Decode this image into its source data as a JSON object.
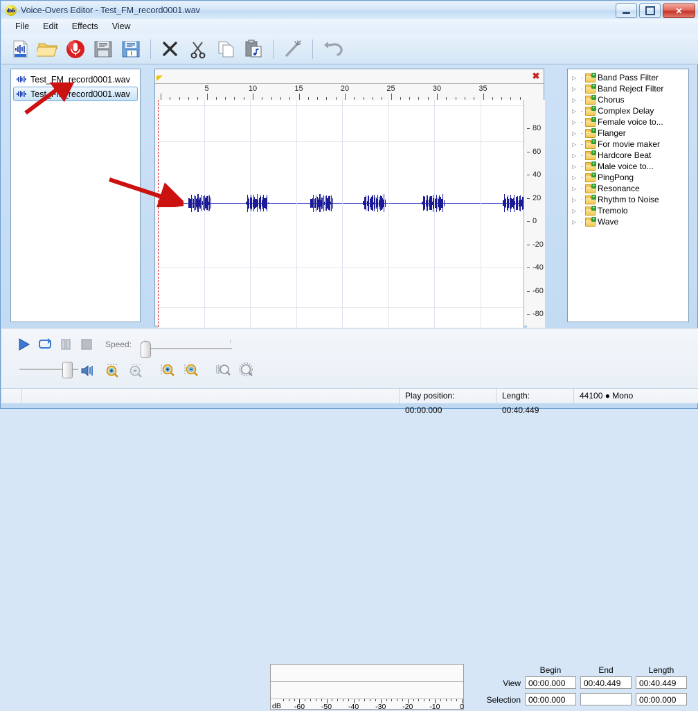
{
  "window": {
    "title": "Voice-Overs Editor - Test_FM_record0001.wav",
    "app_icon": "waveform-icon",
    "minimize": "–",
    "maximize": "▫",
    "close": "✕"
  },
  "menu": {
    "items": [
      "File",
      "Edit",
      "Effects",
      "View"
    ]
  },
  "toolbar": {
    "buttons": [
      {
        "name": "new-file-icon",
        "label": "New"
      },
      {
        "name": "open-folder-icon",
        "label": "Open"
      },
      {
        "name": "record-icon",
        "label": "Record"
      },
      {
        "name": "save-icon",
        "label": "Save"
      },
      {
        "name": "save-as-icon",
        "label": "Save As"
      },
      {
        "name": "delete-icon",
        "label": "Delete"
      },
      {
        "name": "cut-icon",
        "label": "Cut"
      },
      {
        "name": "copy-icon",
        "label": "Copy"
      },
      {
        "name": "paste-icon",
        "label": "Paste"
      },
      {
        "name": "magic-wand-icon",
        "label": "Effects"
      },
      {
        "name": "undo-icon",
        "label": "Undo"
      }
    ]
  },
  "file_list": {
    "items": [
      {
        "label": "Test_FM_record0001.wav",
        "selected": false
      },
      {
        "label": "Test_FM_record0001.wav",
        "selected": true
      }
    ]
  },
  "editor": {
    "close_label": "✖",
    "ruler_ticks": [
      "5",
      "10",
      "15",
      "20",
      "25",
      "30",
      "35"
    ],
    "amplitude_ticks": [
      "80",
      "60",
      "40",
      "20",
      "0",
      "-20",
      "-40",
      "-60",
      "-80"
    ],
    "waveform_color": "#1b1b96",
    "centerline_color": "#4b4bd6",
    "playhead_color": "#e02020"
  },
  "effects": {
    "items": [
      "Band Pass Filter",
      "Band Reject Filter",
      "Chorus",
      "Complex Delay",
      "Female voice to...",
      "Flanger",
      "For movie maker",
      "Hardcore Beat",
      "Male voice to...",
      "PingPong",
      "Resonance",
      "Rhythm to Noise",
      "Tremolo",
      "Wave"
    ]
  },
  "transport": {
    "play": "▶",
    "loop": "loop-icon",
    "pause": "pause-icon",
    "stop": "stop-icon",
    "speed_label": "Speed:",
    "volume_icon": "speaker-icon",
    "zoom_buttons": [
      "zoom-in-vertical-icon",
      "zoom-out-vertical-icon",
      "zoom-in-horizontal-icon",
      "zoom-out-horizontal-icon",
      "zoom-selection-icon",
      "zoom-all-icon"
    ]
  },
  "meter": {
    "unit_label": "dB",
    "scale": [
      "-60",
      "-50",
      "-40",
      "-30",
      "-20",
      "-10",
      "0"
    ]
  },
  "time_fields": {
    "headers": [
      "Begin",
      "End",
      "Length"
    ],
    "rows": [
      {
        "label": "View",
        "begin": "00:00.000",
        "end": "00:40.449",
        "length": "00:40.449"
      },
      {
        "label": "Selection",
        "begin": "00:00.000",
        "end": "",
        "length": "00:00.000"
      }
    ]
  },
  "status_bar": {
    "left": "",
    "play_position": "Play position: 00:00.000",
    "length": "Length: 00:40.449",
    "format": "44100 ● Mono"
  },
  "annotations": {
    "arrow_color": "#cc1111",
    "arrow_1_target": "selected-file-item",
    "arrow_2_target": "waveform-start"
  }
}
